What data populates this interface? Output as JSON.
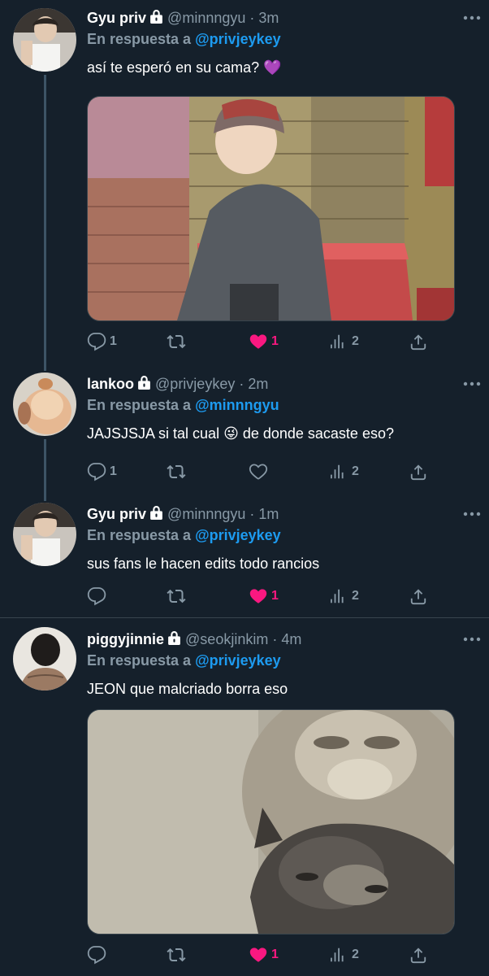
{
  "tweets": [
    {
      "name": "Gyu priv",
      "handle": "@minnngyu",
      "dot": "·",
      "time": "3m",
      "reply_prefix": "En respuesta a",
      "reply_to": "@privjeykey",
      "text": "así te esperó en su cama? 💜",
      "reply_count": "1",
      "like_count": "1",
      "view_count": "2",
      "liked": true
    },
    {
      "name": "lankoo",
      "handle": "@privjeykey",
      "dot": "·",
      "time": "2m",
      "reply_prefix": "En respuesta a",
      "reply_to": "@minnngyu",
      "text": "JAJSJSJA si tal cual 😜 de donde sacaste eso?",
      "reply_count": "1",
      "like_count": "",
      "view_count": "2",
      "liked": false
    },
    {
      "name": "Gyu priv",
      "handle": "@minnngyu",
      "dot": "·",
      "time": "1m",
      "reply_prefix": "En respuesta a",
      "reply_to": "@privjeykey",
      "text": "sus fans le hacen edits todo rancios",
      "reply_count": "",
      "like_count": "1",
      "view_count": "2",
      "liked": true
    },
    {
      "name": "piggyjinnie",
      "handle": "@seokjinkim",
      "dot": "·",
      "time": "4m",
      "reply_prefix": "En respuesta a",
      "reply_to": "@privjeykey",
      "text": "JEON que malcriado borra eso",
      "reply_count": "",
      "like_count": "1",
      "view_count": "2",
      "liked": true
    }
  ],
  "colors": {
    "background": "#15202b",
    "secondary_text": "#8899a6",
    "mention": "#1d9bf0",
    "like": "#f91880",
    "divider": "#38444d"
  }
}
